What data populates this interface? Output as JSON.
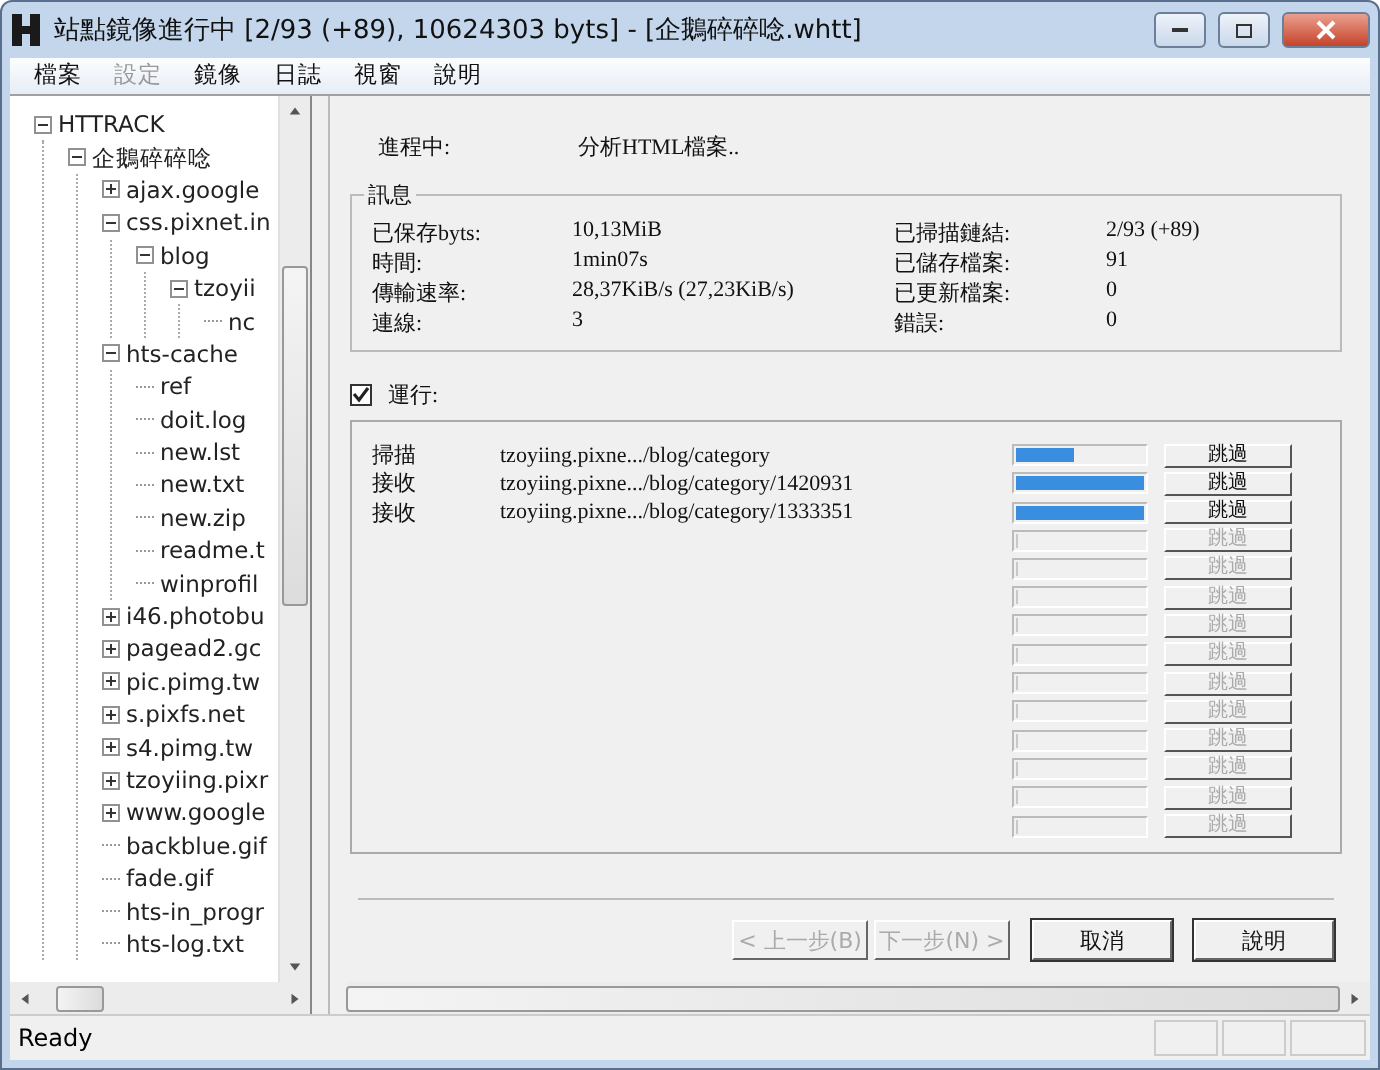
{
  "window": {
    "title": "站點鏡像進行中 [2/93 (+89), 10624303 byts] - [企鵝碎碎唸.whtt]"
  },
  "menu": [
    {
      "label": "檔案",
      "disabled": false
    },
    {
      "label": "設定",
      "disabled": true
    },
    {
      "label": "鏡像",
      "disabled": false
    },
    {
      "label": "日誌",
      "disabled": false
    },
    {
      "label": "視窗",
      "disabled": false
    },
    {
      "label": "說明",
      "disabled": false
    }
  ],
  "tree": [
    {
      "label": "HTTRACK",
      "expanded": true,
      "children": [
        {
          "label": "企鵝碎碎唸",
          "expanded": true,
          "children": [
            {
              "label": "ajax.google",
              "expanded": false
            },
            {
              "label": "css.pixnet.in",
              "expanded": true,
              "children": [
                {
                  "label": "blog",
                  "expanded": true,
                  "children": [
                    {
                      "label": "tzoyii",
                      "expanded": true,
                      "children": [
                        {
                          "label": "nc"
                        }
                      ]
                    }
                  ]
                }
              ]
            },
            {
              "label": "hts-cache",
              "expanded": true,
              "children": [
                {
                  "label": "ref"
                },
                {
                  "label": "doit.log"
                },
                {
                  "label": "new.lst"
                },
                {
                  "label": "new.txt"
                },
                {
                  "label": "new.zip"
                },
                {
                  "label": "readme.t"
                },
                {
                  "label": "winprofil"
                }
              ]
            },
            {
              "label": "i46.photobu",
              "expanded": false
            },
            {
              "label": "pagead2.gc",
              "expanded": false
            },
            {
              "label": "pic.pimg.tw",
              "expanded": false
            },
            {
              "label": "s.pixfs.net",
              "expanded": false
            },
            {
              "label": "s4.pimg.tw",
              "expanded": false
            },
            {
              "label": "tzoyiing.pixr",
              "expanded": false
            },
            {
              "label": "www.google",
              "expanded": false
            },
            {
              "label": "backblue.gif"
            },
            {
              "label": "fade.gif"
            },
            {
              "label": "hts-in_progr"
            },
            {
              "label": "hts-log.txt"
            }
          ]
        }
      ]
    }
  ],
  "progress": {
    "label": "進程中:",
    "value": "分析HTML檔案.."
  },
  "info": {
    "title": "訊息",
    "left": [
      {
        "label": "已保存byts:",
        "value": "10,13MiB"
      },
      {
        "label": "時間:",
        "value": "1min07s"
      },
      {
        "label": "傳輸速率:",
        "value": "28,37KiB/s (27,23KiB/s)"
      },
      {
        "label": "連線:",
        "value": "3"
      }
    ],
    "right": [
      {
        "label": "已掃描鏈結:",
        "value": "2/93 (+89)"
      },
      {
        "label": "已儲存檔案:",
        "value": "91"
      },
      {
        "label": "已更新檔案:",
        "value": "0"
      },
      {
        "label": "錯誤:",
        "value": "0"
      }
    ]
  },
  "running": {
    "label": "運行:",
    "checked": true
  },
  "tasks": [
    {
      "action": "掃描",
      "url": "tzoyiing.pixne.../blog/category",
      "level": 0.45,
      "button": "跳過",
      "disabled": false
    },
    {
      "action": "接收",
      "url": "tzoyiing.pixne.../blog/category/1420931",
      "level": 1,
      "button": "跳過",
      "disabled": false
    },
    {
      "action": "接收",
      "url": "tzoyiing.pixne.../blog/category/1333351",
      "level": 1,
      "button": "跳過",
      "disabled": false
    },
    {
      "level": 0,
      "button": "跳過",
      "disabled": true
    },
    {
      "level": 0,
      "button": "跳過",
      "disabled": true
    },
    {
      "level": 0,
      "button": "跳過",
      "disabled": true
    },
    {
      "level": 0,
      "button": "跳過",
      "disabled": true
    },
    {
      "level": 0,
      "button": "跳過",
      "disabled": true
    },
    {
      "level": 0,
      "button": "跳過",
      "disabled": true
    },
    {
      "level": 0,
      "button": "跳過",
      "disabled": true
    },
    {
      "level": 0,
      "button": "跳過",
      "disabled": true
    },
    {
      "level": 0,
      "button": "跳過",
      "disabled": true
    },
    {
      "level": 0,
      "button": "跳過",
      "disabled": true
    },
    {
      "level": 0,
      "button": "跳過",
      "disabled": true
    }
  ],
  "buttons": [
    {
      "label": "< 上一步(B)",
      "disabled": true
    },
    {
      "label": "下一步(N) >",
      "disabled": true
    },
    {
      "label": "取消",
      "disabled": false
    },
    {
      "label": "說明",
      "disabled": false
    }
  ],
  "status_bar": {
    "text": "Ready"
  }
}
